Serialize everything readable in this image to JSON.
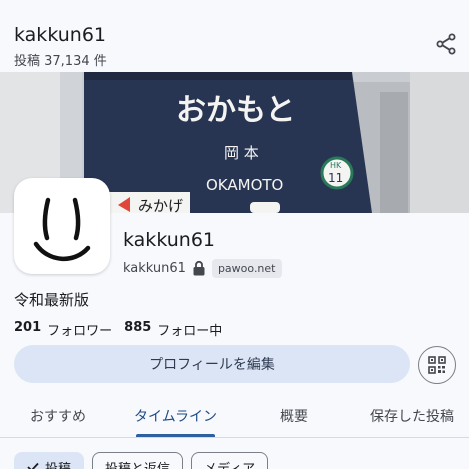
{
  "header": {
    "title": "kakkun61",
    "post_count": "投稿 37,134 件",
    "share_icon": "share-icon"
  },
  "banner": {
    "station_hiragana": "おかもと",
    "station_kanji": "岡 本",
    "station_romaji": "OKAMOTO",
    "station_code_top": "HK",
    "station_code_num": "11",
    "next_station": "みかげ",
    "colors": {
      "sign_bg": "#283552",
      "sign_face": "#f4f4f2",
      "code_ring": "#2a7a5a"
    }
  },
  "profile": {
    "display_name": "kakkun61",
    "handle": "kakkun61",
    "domain": "pawoo.net",
    "bio": "令和最新版",
    "followers_count": "201",
    "followers_label": "フォロワー",
    "following_count": "885",
    "following_label": "フォロー中",
    "edit_button": "プロフィールを編集"
  },
  "tabs": [
    {
      "label": "おすすめ",
      "active": false
    },
    {
      "label": "タイムライン",
      "active": true
    },
    {
      "label": "概要",
      "active": false
    },
    {
      "label": "保存した投稿",
      "active": false
    }
  ],
  "filters": [
    {
      "label": "投稿",
      "selected": true
    },
    {
      "label": "投稿と返信",
      "selected": false
    },
    {
      "label": "メディア",
      "selected": false
    }
  ],
  "colors": {
    "accent": "#2d5fa3",
    "button_bg": "#dbe5f5",
    "surface": "#f7f9fd"
  }
}
